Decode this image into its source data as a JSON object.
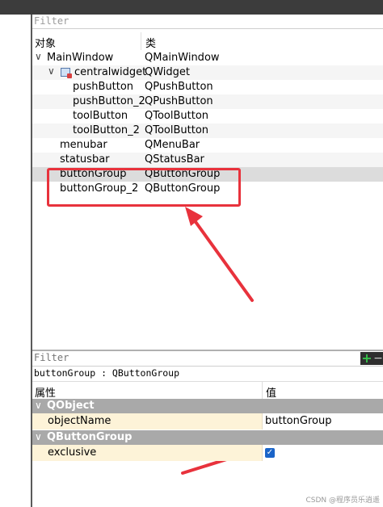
{
  "object_inspector": {
    "filter_placeholder": "Filter",
    "col_object": "对象",
    "col_class": "类",
    "rows": [
      {
        "name": "MainWindow",
        "class": "QMainWindow"
      },
      {
        "name": "centralwidget",
        "class": "QWidget"
      },
      {
        "name": "pushButton",
        "class": "QPushButton"
      },
      {
        "name": "pushButton_2",
        "class": "QPushButton"
      },
      {
        "name": "toolButton",
        "class": "QToolButton"
      },
      {
        "name": "toolButton_2",
        "class": "QToolButton"
      },
      {
        "name": "menubar",
        "class": "QMenuBar"
      },
      {
        "name": "statusbar",
        "class": "QStatusBar"
      },
      {
        "name": "buttonGroup",
        "class": "QButtonGroup"
      },
      {
        "name": "buttonGroup_2",
        "class": "QButtonGroup"
      }
    ]
  },
  "property_editor": {
    "filter_placeholder": "Filter",
    "add_label": "+",
    "remove_label": "−",
    "object_line": "buttonGroup : QButtonGroup",
    "col_property": "属性",
    "col_value": "值",
    "groups": [
      {
        "name": "QObject",
        "props": [
          {
            "name": "objectName",
            "value": "buttonGroup"
          }
        ]
      },
      {
        "name": "QButtonGroup",
        "props": [
          {
            "name": "exclusive",
            "value": true
          }
        ]
      }
    ]
  },
  "annotation": {
    "color": "#e8323c"
  },
  "watermark": "CSDN @程序员乐逍遥"
}
